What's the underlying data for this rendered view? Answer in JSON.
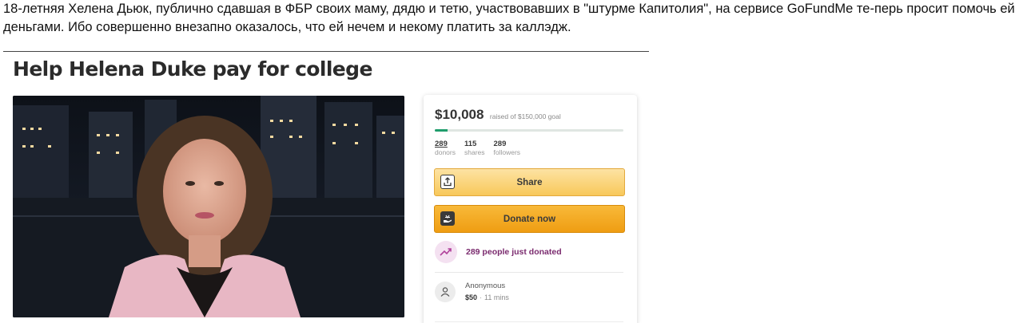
{
  "post": {
    "text": "18-летняя Хелена Дьюк, публично сдавшая в ФБР своих маму, дядю и тетю, участвовавших в \"штурме Капитолия\", на сервисе GoFundMe те-перь просит помочь ей деньгами. Ибо совершенно внезапно оказалось, что ей нечем и некому платить за каллэдж."
  },
  "campaign": {
    "title": "Help Helena Duke pay for college"
  },
  "card": {
    "amount": "$10,008",
    "goal_text": "raised of $150,000 goal",
    "progress_fraction": 0.067,
    "stats": [
      {
        "value": "289",
        "label": "donors"
      },
      {
        "value": "115",
        "label": "shares"
      },
      {
        "value": "289",
        "label": "followers"
      }
    ],
    "share_label": "Share",
    "donate_label": "Donate now",
    "recent_donations": "289 people just donated",
    "donor": {
      "name": "Anonymous",
      "amount": "$50",
      "separator": "·",
      "time": "11 mins"
    }
  },
  "colors": {
    "progress": "#1f9d6c",
    "share_button": "#f8c85a",
    "donate_button": "#ef9d12",
    "recent_text": "#7a2a6e"
  },
  "icons": {
    "share": "share-upload-icon",
    "donate": "donate-hand-icon",
    "trend": "trending-up-icon",
    "donor": "donor-avatar-icon"
  }
}
